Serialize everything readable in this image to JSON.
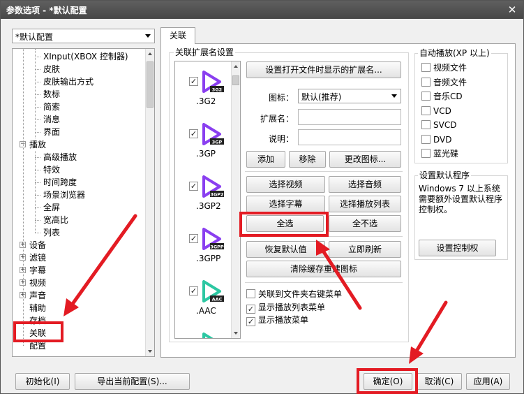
{
  "window": {
    "title": "参数选项 - *默认配置",
    "close_glyph": "✕"
  },
  "profile": {
    "selected": "*默认配置"
  },
  "tree": {
    "items": [
      {
        "label": "XInput(XBOX 控制器)",
        "level": 2
      },
      {
        "label": "皮肤",
        "level": 2
      },
      {
        "label": "皮肤输出方式",
        "level": 2
      },
      {
        "label": "数标",
        "level": 2
      },
      {
        "label": "简索",
        "level": 2
      },
      {
        "label": "消息",
        "level": 2
      },
      {
        "label": "界面",
        "level": 2
      },
      {
        "label": "播放",
        "level": 1,
        "expander": "−"
      },
      {
        "label": "高级播放",
        "level": 2
      },
      {
        "label": "特效",
        "level": 2
      },
      {
        "label": "时间跨度",
        "level": 2
      },
      {
        "label": "场景浏览器",
        "level": 2
      },
      {
        "label": "全屏",
        "level": 2
      },
      {
        "label": "宽高比",
        "level": 2
      },
      {
        "label": "列表",
        "level": 2
      },
      {
        "label": "设备",
        "level": 1,
        "expander": "+"
      },
      {
        "label": "滤镜",
        "level": 1,
        "expander": "+"
      },
      {
        "label": "字幕",
        "level": 1,
        "expander": "+"
      },
      {
        "label": "视频",
        "level": 1,
        "expander": "+"
      },
      {
        "label": "声音",
        "level": 1,
        "expander": "+"
      },
      {
        "label": "辅助",
        "level": 1
      },
      {
        "label": "存档",
        "level": 1
      },
      {
        "label": "关联",
        "level": 1
      },
      {
        "label": "配置",
        "level": 1
      }
    ]
  },
  "tab": {
    "label": "关联"
  },
  "ext_group": {
    "title": "关联扩展名设置",
    "files": [
      {
        "ext": ".3G2",
        "badge": "3G2",
        "color": "#8a3ff0",
        "checked": true
      },
      {
        "ext": ".3GP",
        "badge": "3GP",
        "color": "#8a3ff0",
        "checked": true
      },
      {
        "ext": ".3GP2",
        "badge": "3GP2",
        "color": "#8a3ff0",
        "checked": true
      },
      {
        "ext": ".3GPP",
        "badge": "3GPP",
        "color": "#8a3ff0",
        "checked": true
      },
      {
        "ext": ".AAC",
        "badge": "AAC",
        "color": "#2cc7a2",
        "checked": true
      },
      {
        "ext": "",
        "badge": "",
        "color": "#2cc7a2",
        "checked": false
      }
    ],
    "check_glyph": "✓",
    "btn_set_ext": "设置打开文件时显示的扩展名...",
    "icon_label": "图标：",
    "icon_value": "默认(推荐)",
    "ext_label": "扩展名：",
    "desc_label": "说明：",
    "btn_add": "添加",
    "btn_remove": "移除",
    "btn_change_icon": "更改图标...",
    "btn_sel_video": "选择视频",
    "btn_sel_audio": "选择音频",
    "btn_sel_sub": "选择字幕",
    "btn_sel_playlist": "选择播放列表",
    "btn_sel_all": "全选",
    "btn_sel_none": "全不选",
    "btn_restore": "恢复默认值",
    "btn_refresh": "立即刷新",
    "btn_clear_cache": "清除缓存重建图标",
    "opt_folder_menu": "关联到文件夹右键菜单",
    "opt_playlist_menu": "显示播放列表菜单",
    "opt_play_menu": "显示播放菜单"
  },
  "autoplay_group": {
    "title": "自动播放(XP 以上)",
    "items": [
      "视频文件",
      "音频文件",
      "音乐CD",
      "VCD",
      "SVCD",
      "DVD",
      "蓝光碟"
    ]
  },
  "default_group": {
    "title": "设置默认程序",
    "text": "Windows 7 以上系统需要额外设置默认程序控制权。",
    "btn": "设置控制权"
  },
  "footer": {
    "btn_init": "初始化(I)",
    "btn_export": "导出当前配置(S)...",
    "btn_ok": "确定(O)",
    "btn_cancel": "取消(C)",
    "btn_apply": "应用(A)"
  },
  "colors": {
    "annotation": "#e31b23",
    "titlebar": "#4f4f4f"
  }
}
